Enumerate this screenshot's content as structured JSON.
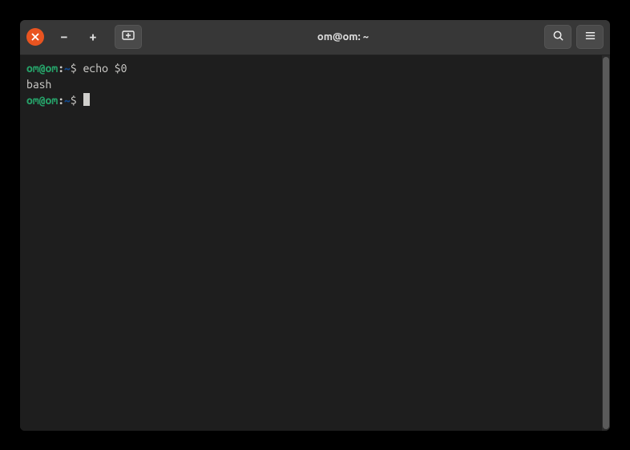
{
  "window": {
    "title": "om@om: ~"
  },
  "terminal": {
    "lines": [
      {
        "prompt_user": "om@om",
        "prompt_sep": ":",
        "prompt_path": "~",
        "prompt_symbol": "$ ",
        "command": "echo $0"
      },
      {
        "output": "bash"
      },
      {
        "prompt_user": "om@om",
        "prompt_sep": ":",
        "prompt_path": "~",
        "prompt_symbol": "$ ",
        "command": "",
        "cursor": true
      }
    ]
  },
  "colors": {
    "close_button": "#e95420",
    "prompt_user": "#26a269",
    "prompt_path": "#12488b",
    "bg_titlebar": "#373737",
    "bg_terminal": "#1e1e1e",
    "text": "#d0cfcc"
  }
}
